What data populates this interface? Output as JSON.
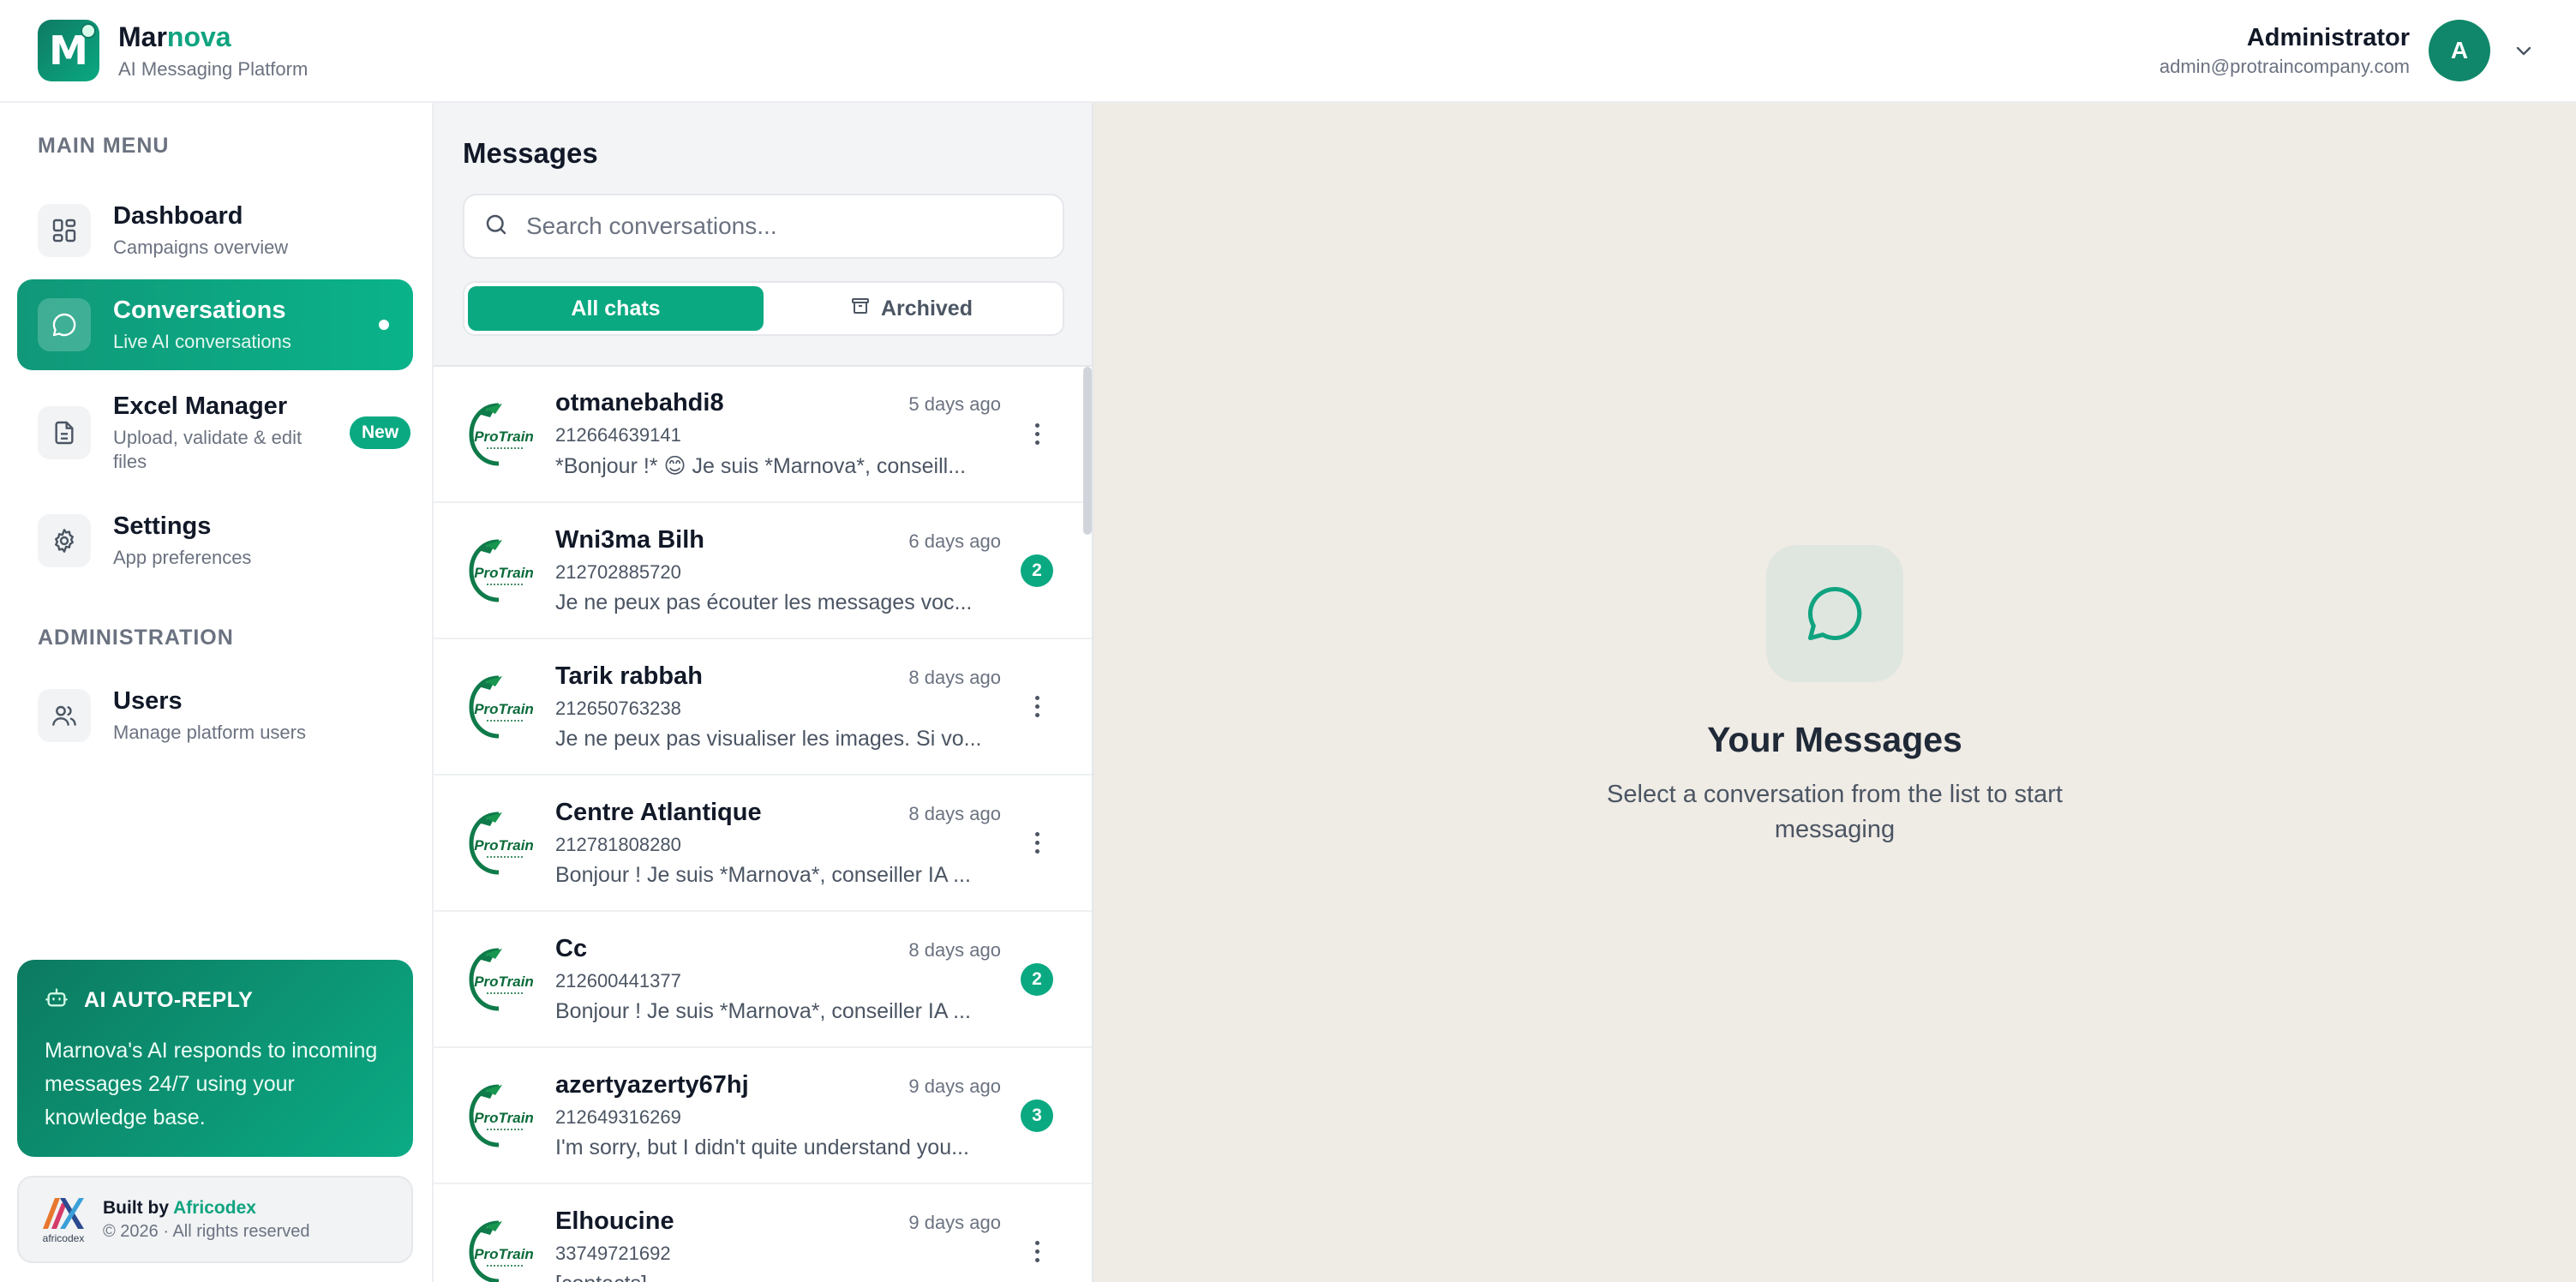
{
  "brand": {
    "name_prefix": "Mar",
    "name_accent": "nova",
    "logo_letter": "M",
    "subtitle": "AI Messaging Platform",
    "accent_color": "#10a37f"
  },
  "user": {
    "name": "Administrator",
    "email": "admin@protraincompany.com",
    "initial": "A"
  },
  "sidebar": {
    "main_menu_label": "MAIN MENU",
    "admin_label": "ADMINISTRATION",
    "items": [
      {
        "title": "Dashboard",
        "sub": "Campaigns overview",
        "icon": "grid-icon"
      },
      {
        "title": "Conversations",
        "sub": "Live AI conversations",
        "icon": "chat-icon",
        "active": true
      },
      {
        "title": "Excel Manager",
        "sub": "Upload, validate & edit files",
        "icon": "file-icon",
        "badge": "New"
      },
      {
        "title": "Settings",
        "sub": "App preferences",
        "icon": "gear-icon"
      }
    ],
    "admin_items": [
      {
        "title": "Users",
        "sub": "Manage platform users",
        "icon": "users-icon"
      }
    ],
    "autoreply": {
      "title": "AI AUTO-REPLY",
      "body": "Marnova's AI responds to incoming messages 24/7 using your knowledge base."
    },
    "footer": {
      "built_prefix": "Built by",
      "built_link": "Africodex",
      "copyright": "© 2026 · All rights reserved",
      "logo_caption": "africodex"
    }
  },
  "conversations": {
    "title": "Messages",
    "search_placeholder": "Search conversations...",
    "tabs": [
      {
        "label": "All chats",
        "active": true
      },
      {
        "label": "Archived",
        "active": false
      }
    ],
    "avatar_text": "ProTrain",
    "items": [
      {
        "name": "otmanebahdi8",
        "time": "5 days ago",
        "phone": "212664639141",
        "preview": "*Bonjour !* 😊 Je suis *Marnova*, conseill...",
        "unread": null
      },
      {
        "name": "Wni3ma Bilh",
        "time": "6 days ago",
        "phone": "212702885720",
        "preview": "Je ne peux pas écouter les messages voc...",
        "unread": "2"
      },
      {
        "name": "Tarik rabbah",
        "time": "8 days ago",
        "phone": "212650763238",
        "preview": "Je ne peux pas visualiser les images. Si vo...",
        "unread": null
      },
      {
        "name": "Centre Atlantique",
        "time": "8 days ago",
        "phone": "212781808280",
        "preview": "Bonjour ! Je suis *Marnova*, conseiller IA ...",
        "unread": null
      },
      {
        "name": "Cc",
        "time": "8 days ago",
        "phone": "212600441377",
        "preview": "Bonjour ! Je suis *Marnova*, conseiller IA ...",
        "unread": "2"
      },
      {
        "name": "azertyazerty67hj",
        "time": "9 days ago",
        "phone": "212649316269",
        "preview": "I'm sorry, but I didn't quite understand you...",
        "unread": "3"
      },
      {
        "name": "Elhoucine",
        "time": "9 days ago",
        "phone": "33749721692",
        "preview": "[contacts]",
        "unread": null
      }
    ]
  },
  "main": {
    "empty_title": "Your Messages",
    "empty_sub": "Select a conversation from the list to start messaging"
  }
}
